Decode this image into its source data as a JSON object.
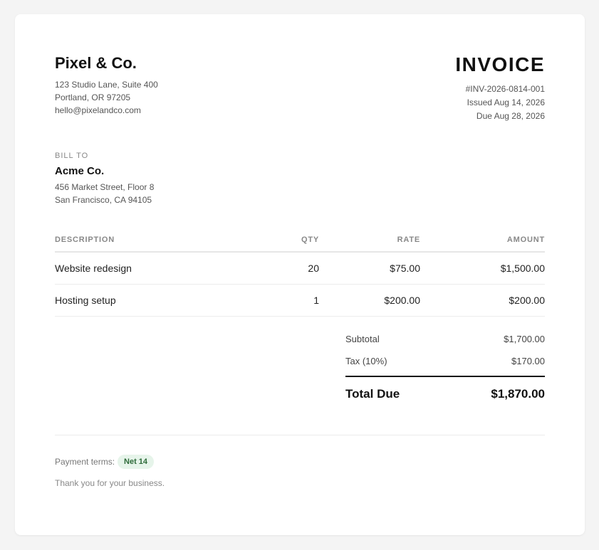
{
  "company": {
    "name": "Pixel & Co.",
    "address_line1": "123 Studio Lane, Suite 400",
    "address_line2": "Portland, OR 97205",
    "email": "hello@pixelandco.com"
  },
  "invoice": {
    "title": "INVOICE",
    "number": "#INV-2026-0814-001",
    "issued": "Issued Aug 14, 2026",
    "due": "Due Aug 28, 2026"
  },
  "bill_to": {
    "label": "BILL TO",
    "name": "Acme Co.",
    "address_line1": "456 Market Street, Floor 8",
    "address_line2": "San Francisco, CA 94105"
  },
  "table": {
    "headers": {
      "description": "DESCRIPTION",
      "qty": "QTY",
      "rate": "RATE",
      "amount": "AMOUNT"
    },
    "rows": [
      {
        "description": "Website redesign",
        "qty": "20",
        "rate": "$75.00",
        "amount": "$1,500.00"
      },
      {
        "description": "Hosting setup",
        "qty": "1",
        "rate": "$200.00",
        "amount": "$200.00"
      }
    ]
  },
  "totals": {
    "subtotal_label": "Subtotal",
    "subtotal_value": "$1,700.00",
    "tax_label": "Tax (10%)",
    "tax_value": "$170.00",
    "total_label": "Total Due",
    "total_value": "$1,870.00"
  },
  "footer": {
    "terms_label": "Payment terms:",
    "terms_badge": "Net 14",
    "thanks": "Thank you for your business."
  },
  "colors": {
    "badge_text": "#2e6b3a",
    "badge_bg": "#e6f4ea",
    "page_bg": "#f4f4f4"
  }
}
